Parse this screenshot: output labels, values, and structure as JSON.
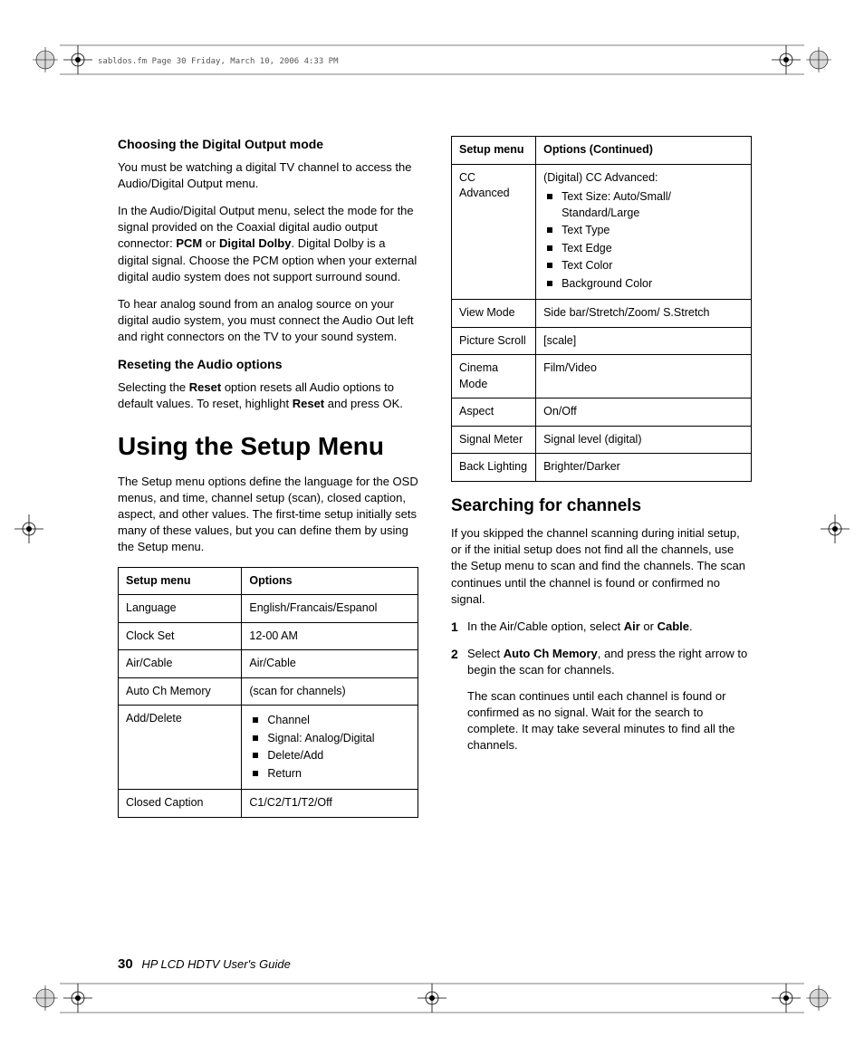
{
  "header_tag": "sabldos.fm  Page 30  Friday, March 10, 2006  4:33 PM",
  "left_col": {
    "h_digital": "Choosing the Digital Output mode",
    "p_digital_1": "You must be watching a digital TV channel to access the Audio/Digital Output menu.",
    "p_digital_2a": "In the Audio/Digital Output menu, select the mode for the signal provided on the Coaxial digital audio output connector: ",
    "p_digital_2_b1": "PCM",
    "p_digital_2_mid": " or ",
    "p_digital_2_b2": "Digital Dolby",
    "p_digital_2b": ". Digital Dolby is a digital signal. Choose the PCM option when your external digital audio system does not support surround sound.",
    "p_digital_3": "To hear analog sound from an analog source on your digital audio system, you must connect the Audio Out left and right connectors on the TV to your sound system.",
    "h_reset": "Reseting the Audio options",
    "p_reset_a": "Selecting the ",
    "p_reset_b1": "Reset",
    "p_reset_mid": " option resets all Audio options to default values. To reset, highlight ",
    "p_reset_b2": "Reset",
    "p_reset_end": " and press OK.",
    "h_setup": "Using the Setup Menu",
    "p_setup": "The Setup menu options define the language for the OSD menus, and time, channel setup (scan), closed caption, aspect, and other values. The first-time setup initially sets many of these values, but you can define them by using the Setup menu.",
    "table1": {
      "th1": "Setup menu",
      "th2": "Options",
      "rows": [
        {
          "k": "Language",
          "v": "English/Francais/Espanol"
        },
        {
          "k": "Clock Set",
          "v": "12-00 AM"
        },
        {
          "k": "Air/Cable",
          "v": "Air/Cable"
        },
        {
          "k": "Auto Ch Memory",
          "v": "(scan for channels)"
        },
        {
          "k": "Add/Delete",
          "list": [
            "Channel",
            "Signal: Analog/Digital",
            "Delete/Add",
            "Return"
          ]
        },
        {
          "k": "Closed Caption",
          "v": "C1/C2/T1/T2/Off"
        }
      ]
    }
  },
  "right_col": {
    "table2": {
      "th1": "Setup menu",
      "th2": "Options (Continued)",
      "cc_label": "CC Advanced",
      "cc_intro": "(Digital) CC Advanced:",
      "cc_list": [
        "Text Size: Auto/Small/ Standard/Large",
        "Text Type",
        "Text Edge",
        "Text Color",
        "Background Color"
      ],
      "rows": [
        {
          "k": "View Mode",
          "v": "Side bar/Stretch/Zoom/ S.Stretch"
        },
        {
          "k": "Picture Scroll",
          "v": "[scale]"
        },
        {
          "k": "Cinema Mode",
          "v": "Film/Video"
        },
        {
          "k": "Aspect",
          "v": "On/Off"
        },
        {
          "k": "Signal Meter",
          "v": "Signal level (digital)"
        },
        {
          "k": "Back Lighting",
          "v": "Brighter/Darker"
        }
      ]
    },
    "h_search": "Searching for channels",
    "p_search": "If you skipped the channel scanning during initial setup, or if the initial setup does not find all the channels, use the Setup menu to scan and find the channels. The scan continues until the channel is found or confirmed no signal.",
    "step1_a": "In the Air/Cable option, select ",
    "step1_b1": "Air",
    "step1_mid": " or ",
    "step1_b2": "Cable",
    "step1_end": ".",
    "step2_a": "Select ",
    "step2_b": "Auto Ch Memory",
    "step2_end": ", and press the right arrow to begin the scan for channels.",
    "step2_p2": "The scan continues until each channel is found or confirmed as no signal. Wait for the search to complete. It may take several minutes to find all the channels."
  },
  "footer": {
    "page": "30",
    "title": "HP LCD HDTV User's Guide"
  }
}
